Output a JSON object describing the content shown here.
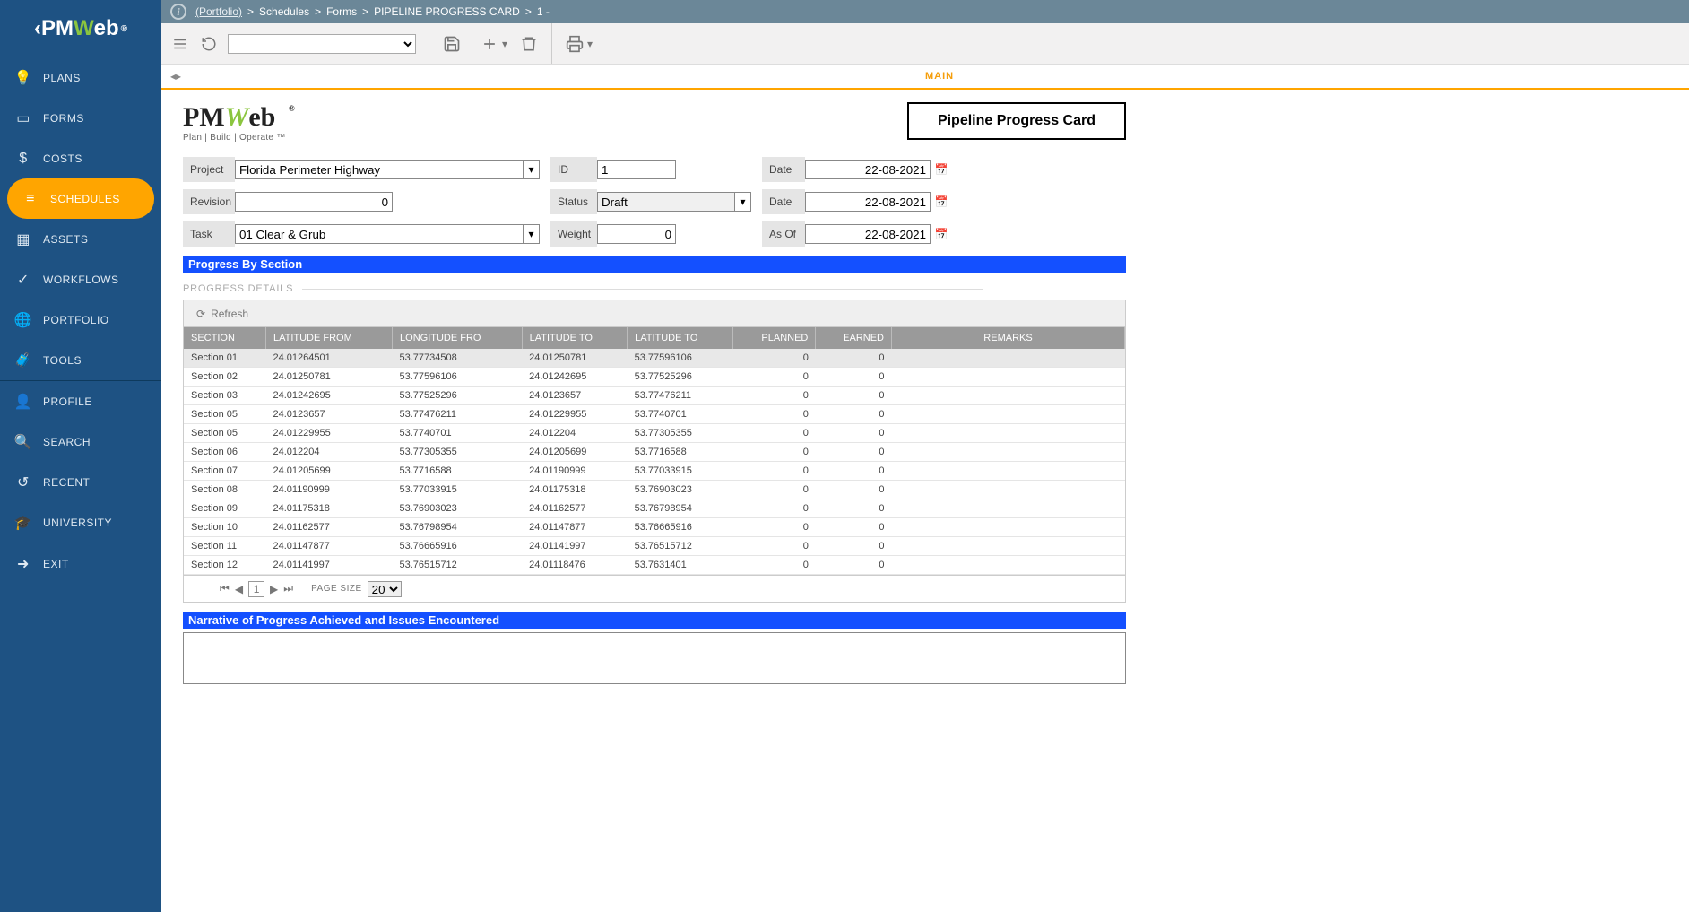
{
  "breadcrumb": {
    "portfolio": "(Portfolio)",
    "schedules": "Schedules",
    "forms": "Forms",
    "card": "PIPELINE PROGRESS CARD",
    "num": "1 -"
  },
  "sidebar": {
    "plans": "PLANS",
    "forms": "FORMS",
    "costs": "COSTS",
    "schedules": "SCHEDULES",
    "assets": "ASSETS",
    "workflows": "WORKFLOWS",
    "portfolio": "PORTFOLIO",
    "tools": "TOOLS",
    "profile": "PROFILE",
    "search": "SEARCH",
    "recent": "RECENT",
    "university": "UNIVERSITY",
    "exit": "EXIT"
  },
  "tab_main": "MAIN",
  "brand_sub": "Plan | Build | Operate ™",
  "card_title": "Pipeline Progress Card",
  "labels": {
    "project": "Project",
    "revision": "Revision",
    "task": "Task",
    "id": "ID",
    "status": "Status",
    "weight": "Weight",
    "date1": "Date",
    "date2": "Date",
    "asof": "As Of"
  },
  "fields": {
    "project": "Florida Perimeter Highway",
    "revision": "0",
    "task": "01 Clear & Grub",
    "id": "1",
    "status": "Draft",
    "weight": "0",
    "date1": "22-08-2021",
    "date2": "22-08-2021",
    "asof": "22-08-2021"
  },
  "section_progress": "Progress By Section",
  "progress_details": "PROGRESS DETAILS",
  "refresh": "Refresh",
  "cols": {
    "section": "SECTION",
    "latfrom": "LATITUDE FROM",
    "lonfrom": "LONGITUDE FRO",
    "latto": "LATITUDE TO",
    "latto2": "LATITUDE TO",
    "planned": "PLANNED",
    "earned": "EARNED",
    "remarks": "REMARKS"
  },
  "rows": [
    {
      "section": "Section 01",
      "latfrom": "24.01264501",
      "lonfrom": "53.77734508",
      "latto": "24.01250781",
      "latto2": "53.77596106",
      "planned": "0",
      "earned": "0"
    },
    {
      "section": "Section 02",
      "latfrom": "24.01250781",
      "lonfrom": "53.77596106",
      "latto": "24.01242695",
      "latto2": "53.77525296",
      "planned": "0",
      "earned": "0"
    },
    {
      "section": "Section 03",
      "latfrom": "24.01242695",
      "lonfrom": "53.77525296",
      "latto": "24.0123657",
      "latto2": "53.77476211",
      "planned": "0",
      "earned": "0"
    },
    {
      "section": "Section 05",
      "latfrom": "24.0123657",
      "lonfrom": "53.77476211",
      "latto": "24.01229955",
      "latto2": "53.7740701",
      "planned": "0",
      "earned": "0"
    },
    {
      "section": "Section 05",
      "latfrom": "24.01229955",
      "lonfrom": "53.7740701",
      "latto": "24.012204",
      "latto2": "53.77305355",
      "planned": "0",
      "earned": "0"
    },
    {
      "section": "Section 06",
      "latfrom": "24.012204",
      "lonfrom": "53.77305355",
      "latto": "24.01205699",
      "latto2": "53.7716588",
      "planned": "0",
      "earned": "0"
    },
    {
      "section": "Section 07",
      "latfrom": "24.01205699",
      "lonfrom": "53.7716588",
      "latto": "24.01190999",
      "latto2": "53.77033915",
      "planned": "0",
      "earned": "0"
    },
    {
      "section": "Section 08",
      "latfrom": "24.01190999",
      "lonfrom": "53.77033915",
      "latto": "24.01175318",
      "latto2": "53.76903023",
      "planned": "0",
      "earned": "0"
    },
    {
      "section": "Section 09",
      "latfrom": "24.01175318",
      "lonfrom": "53.76903023",
      "latto": "24.01162577",
      "latto2": "53.76798954",
      "planned": "0",
      "earned": "0"
    },
    {
      "section": "Section 10",
      "latfrom": "24.01162577",
      "lonfrom": "53.76798954",
      "latto": "24.01147877",
      "latto2": "53.76665916",
      "planned": "0",
      "earned": "0"
    },
    {
      "section": "Section 11",
      "latfrom": "24.01147877",
      "lonfrom": "53.76665916",
      "latto": "24.01141997",
      "latto2": "53.76515712",
      "planned": "0",
      "earned": "0"
    },
    {
      "section": "Section 12",
      "latfrom": "24.01141997",
      "lonfrom": "53.76515712",
      "latto": "24.01118476",
      "latto2": "53.7631401",
      "planned": "0",
      "earned": "0"
    }
  ],
  "pager": {
    "page": "1",
    "psize_label": "PAGE SIZE",
    "psize": "20"
  },
  "narrative": "Narrative of Progress Achieved and Issues Encountered"
}
